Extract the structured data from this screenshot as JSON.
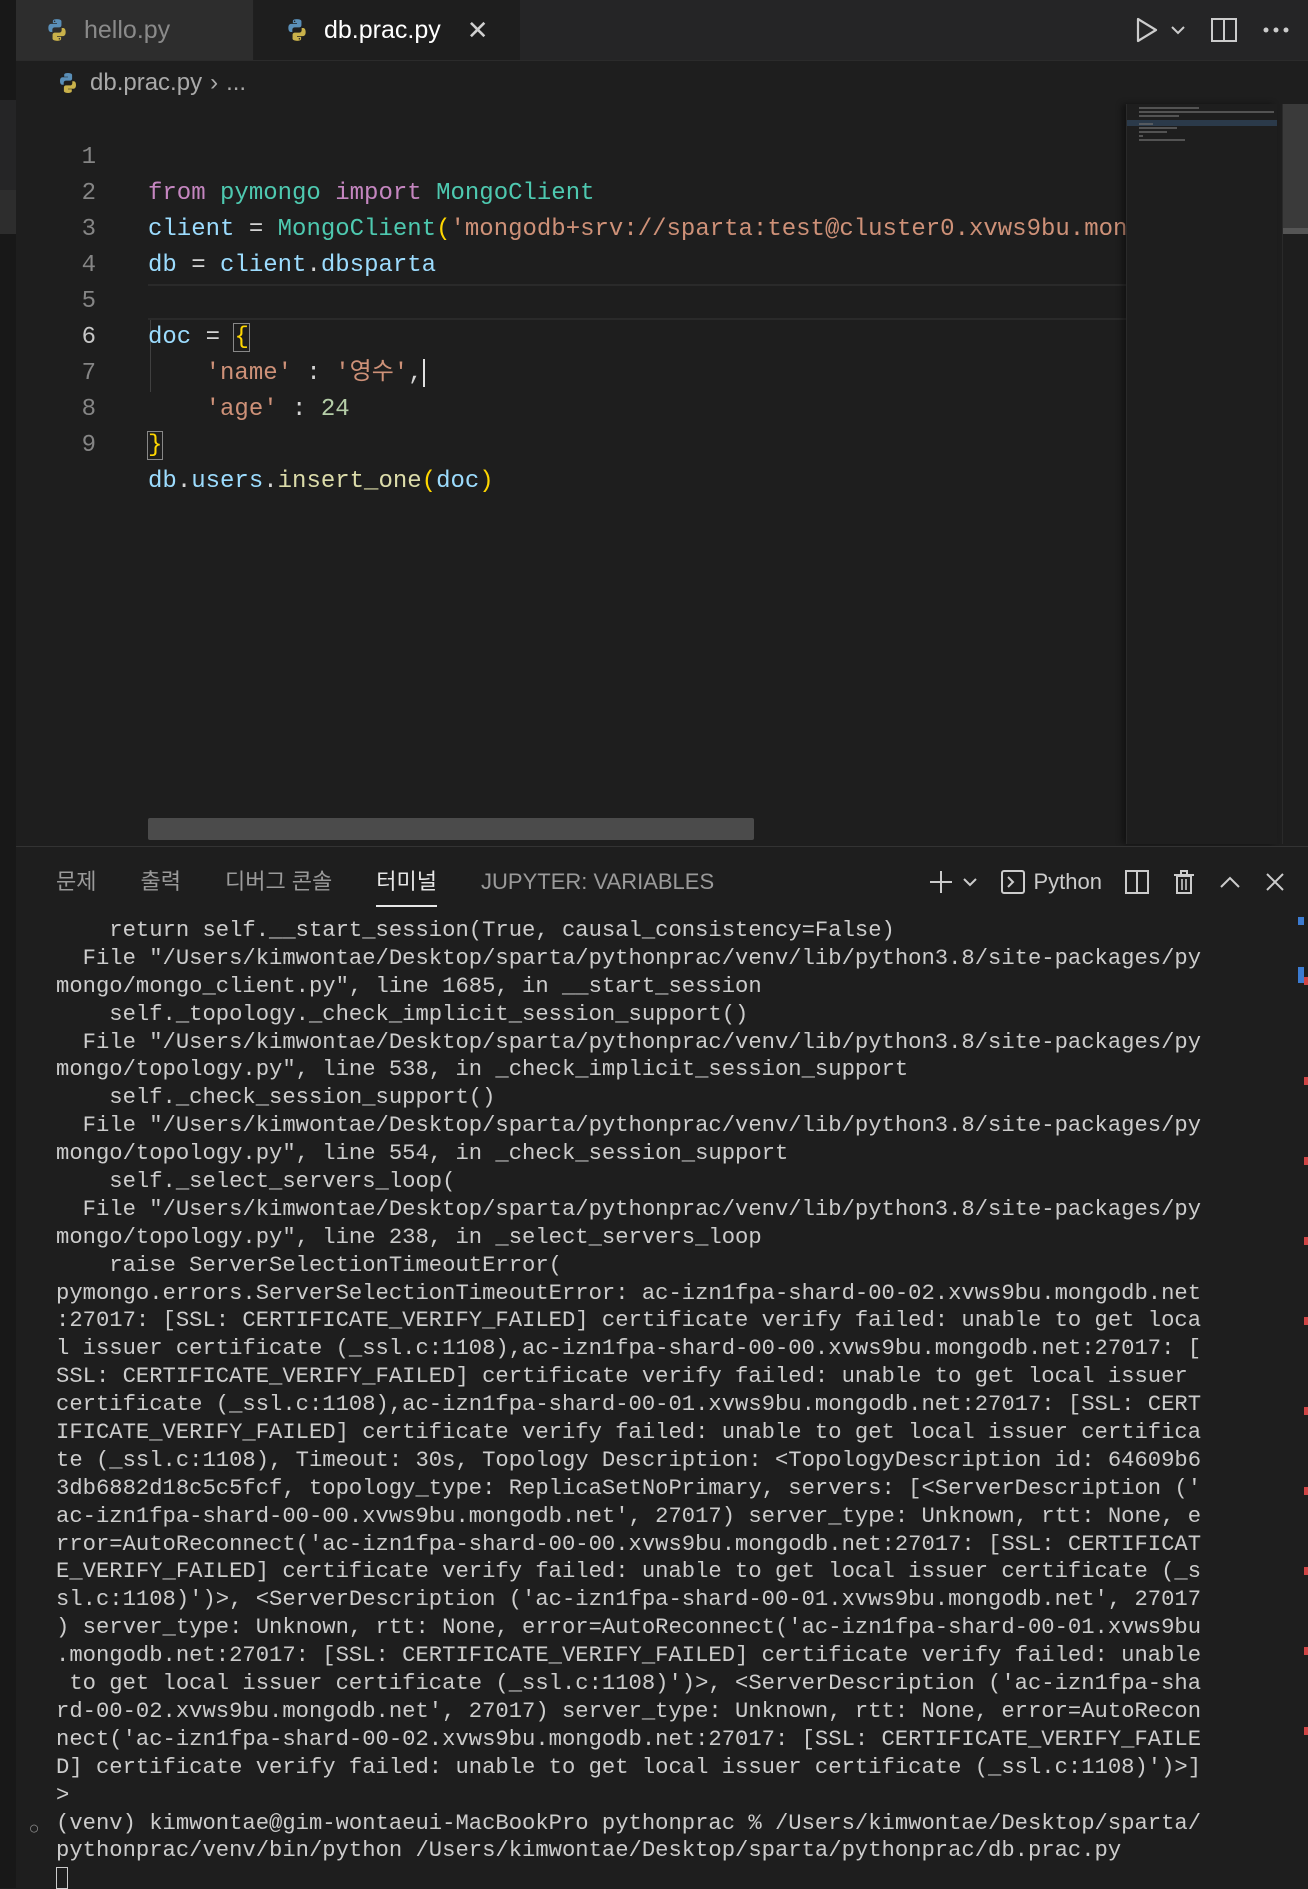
{
  "tabs": [
    {
      "label": "hello.py",
      "active": false
    },
    {
      "label": "db.prac.py",
      "active": true
    }
  ],
  "breadcrumb": {
    "file": "db.prac.py",
    "more": "..."
  },
  "editor": {
    "line_numbers": [
      "1",
      "2",
      "3",
      "4",
      "5",
      "6",
      "7",
      "8",
      "9"
    ],
    "lines": [
      "from pymongo import MongoClient",
      "client = MongoClient('mongodb+srv://sparta:test@cluster0.xvws9bu.mon",
      "db = client.dbsparta",
      "",
      "doc = {",
      "    'name' : '영수',",
      "    'age' : 24",
      "}",
      "db.users.insert_one(doc)"
    ]
  },
  "panel": {
    "tabs": [
      "문제",
      "출력",
      "디버그 콘솔",
      "터미널",
      "JUPYTER: VARIABLES"
    ],
    "active_tab": "터미널",
    "terminal_profile": "Python"
  },
  "terminal": {
    "lines": [
      "    return self.__start_session(True, causal_consistency=False)",
      "  File \"/Users/kimwontae/Desktop/sparta/pythonprac/venv/lib/python3.8/site-packages/py",
      "mongo/mongo_client.py\", line 1685, in __start_session",
      "    self._topology._check_implicit_session_support()",
      "  File \"/Users/kimwontae/Desktop/sparta/pythonprac/venv/lib/python3.8/site-packages/py",
      "mongo/topology.py\", line 538, in _check_implicit_session_support",
      "    self._check_session_support()",
      "  File \"/Users/kimwontae/Desktop/sparta/pythonprac/venv/lib/python3.8/site-packages/py",
      "mongo/topology.py\", line 554, in _check_session_support",
      "    self._select_servers_loop(",
      "  File \"/Users/kimwontae/Desktop/sparta/pythonprac/venv/lib/python3.8/site-packages/py",
      "mongo/topology.py\", line 238, in _select_servers_loop",
      "    raise ServerSelectionTimeoutError(",
      "pymongo.errors.ServerSelectionTimeoutError: ac-izn1fpa-shard-00-02.xvws9bu.mongodb.net",
      ":27017: [SSL: CERTIFICATE_VERIFY_FAILED] certificate verify failed: unable to get loca",
      "l issuer certificate (_ssl.c:1108),ac-izn1fpa-shard-00-00.xvws9bu.mongodb.net:27017: [",
      "SSL: CERTIFICATE_VERIFY_FAILED] certificate verify failed: unable to get local issuer ",
      "certificate (_ssl.c:1108),ac-izn1fpa-shard-00-01.xvws9bu.mongodb.net:27017: [SSL: CERT",
      "IFICATE_VERIFY_FAILED] certificate verify failed: unable to get local issuer certifica",
      "te (_ssl.c:1108), Timeout: 30s, Topology Description: <TopologyDescription id: 64609b6",
      "3db6882d18c5c5fcf, topology_type: ReplicaSetNoPrimary, servers: [<ServerDescription ('",
      "ac-izn1fpa-shard-00-00.xvws9bu.mongodb.net', 27017) server_type: Unknown, rtt: None, e",
      "rror=AutoReconnect('ac-izn1fpa-shard-00-00.xvws9bu.mongodb.net:27017: [SSL: CERTIFICAT",
      "E_VERIFY_FAILED] certificate verify failed: unable to get local issuer certificate (_s",
      "sl.c:1108)')>, <ServerDescription ('ac-izn1fpa-shard-00-01.xvws9bu.mongodb.net', 27017",
      ") server_type: Unknown, rtt: None, error=AutoReconnect('ac-izn1fpa-shard-00-01.xvws9bu",
      ".mongodb.net:27017: [SSL: CERTIFICATE_VERIFY_FAILED] certificate verify failed: unable",
      " to get local issuer certificate (_ssl.c:1108)')>, <ServerDescription ('ac-izn1fpa-sha",
      "rd-00-02.xvws9bu.mongodb.net', 27017) server_type: Unknown, rtt: None, error=AutoRecon",
      "nect('ac-izn1fpa-shard-00-02.xvws9bu.mongodb.net:27017: [SSL: CERTIFICATE_VERIFY_FAILE",
      "D] certificate verify failed: unable to get local issuer certificate (_ssl.c:1108)')>]",
      ">",
      "(venv) kimwontae@gim-wontaeui-MacBookPro pythonprac % /Users/kimwontae/Desktop/sparta/",
      "pythonprac/venv/bin/python /Users/kimwontae/Desktop/sparta/pythonprac/db.prac.py",
      ""
    ]
  }
}
